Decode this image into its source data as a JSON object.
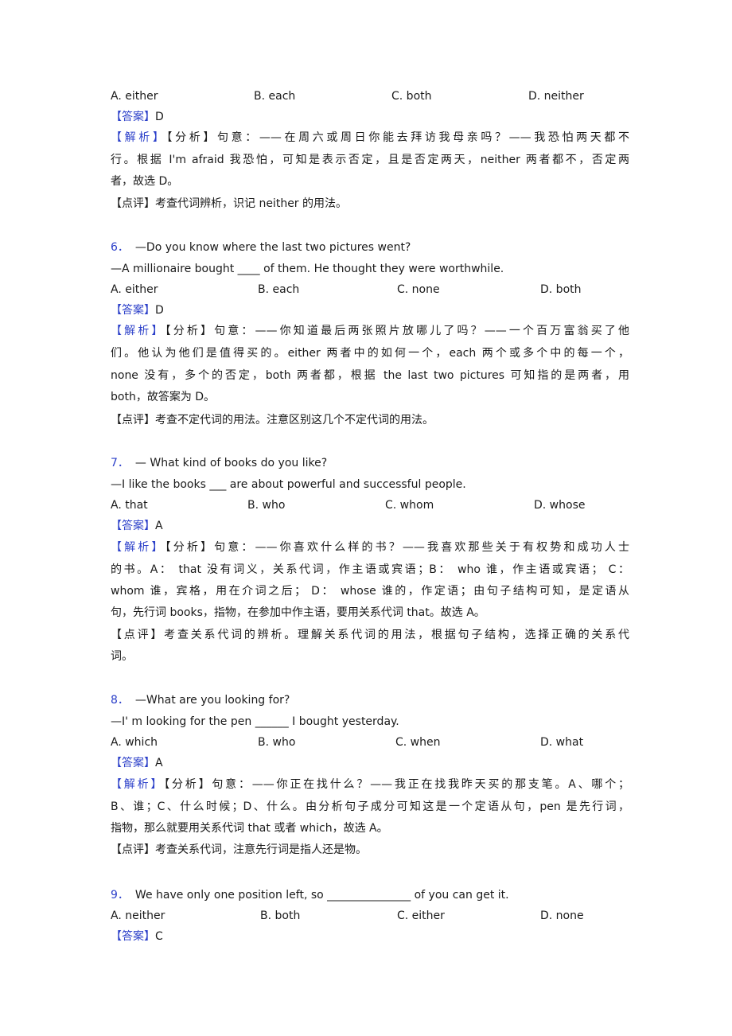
{
  "q5": {
    "options": [
      "A. either",
      "B. each",
      "C. both",
      "D. neither"
    ],
    "answer_label": "【答案】",
    "answer": "D",
    "analysis_label": "【解析】",
    "analysis_lines": [
      "【分析】句意：——在周六或周日你能去拜访我母亲吗？——我恐怕两天都不",
      "行。根据 I'm afraid 我恐怕，可知是表示否定，且是否定两天，neither 两者都不，否定两",
      "者，故选 D。"
    ],
    "comment": "【点评】考查代词辨析，识记 neither 的用法。"
  },
  "q6": {
    "number": "6．",
    "question_line1": "—Do you know where the last two pictures went?",
    "question_line2": "—A millionaire bought ____ of them. He thought they were worthwhile.",
    "options": [
      "A. either",
      "B. each",
      "C. none",
      "D. both"
    ],
    "answer_label": "【答案】",
    "answer": "D",
    "analysis_label": "【解析】",
    "analysis_lines": [
      "【分析】句意：——你知道最后两张照片放哪儿了吗？——一个百万富翁买了他",
      "们。他认为他们是值得买的。either 两者中的如何一个，each 两个或多个中的每一个，",
      "none 没有，多个的否定，both 两者都，根据 the last two pictures 可知指的是两者，用",
      "both，故答案为 D。"
    ],
    "comment": "【点评】考查不定代词的用法。注意区别这几个不定代词的用法。"
  },
  "q7": {
    "number": "7．",
    "question_line1": "— What kind of books do you like?",
    "question_line2": "—I like the books ___ are about powerful and successful people.",
    "options": [
      "A. that",
      "B. who",
      "C. whom",
      "D. whose"
    ],
    "answer_label": "【答案】",
    "answer": "A",
    "analysis_label": "【解析】",
    "analysis_lines": [
      "【分析】句意：——你喜欢什么样的书？——我喜欢那些关于有权势和成功人士",
      "的书。A： that 没有词义，关系代词，作主语或宾语；B： who 谁，作主语或宾语； C：",
      "whom 谁，宾格，用在介词之后； D： whose 谁的，作定语；由句子结构可知，是定语从",
      "句，先行词 books，指物，在参加中作主语，要用关系代词 that。故选 A。"
    ],
    "comment_lines": [
      "【点评】考查关系代词的辨析。理解关系代词的用法，根据句子结构，选择正确的关系代",
      "词。"
    ]
  },
  "q8": {
    "number": "8．",
    "question_line1": "—What are you looking for?",
    "question_line2": "—I' m looking for the pen ______ I bought yesterday.",
    "options": [
      "A. which",
      "B. who",
      "C. when",
      "D. what"
    ],
    "answer_label": "【答案】",
    "answer": "A",
    "analysis_label": "【解析】",
    "analysis_lines": [
      "【分析】句意：——你正在找什么？——我正在找我昨天买的那支笔。A、哪个；",
      "B、谁；C、什么时候；D、什么。由分析句子成分可知这是一个定语从句，pen 是先行词，",
      "指物，那么就要用关系代词 that 或者 which，故选 A。"
    ],
    "comment": "【点评】考查关系代词，注意先行词是指人还是物。"
  },
  "q9": {
    "number": "9．",
    "question_line1": "We have only one position left, so _______________ of you can get it.",
    "options": [
      "A. neither",
      "B. both",
      "C. either",
      "D. none"
    ],
    "answer_label": "【答案】",
    "answer": "C"
  }
}
